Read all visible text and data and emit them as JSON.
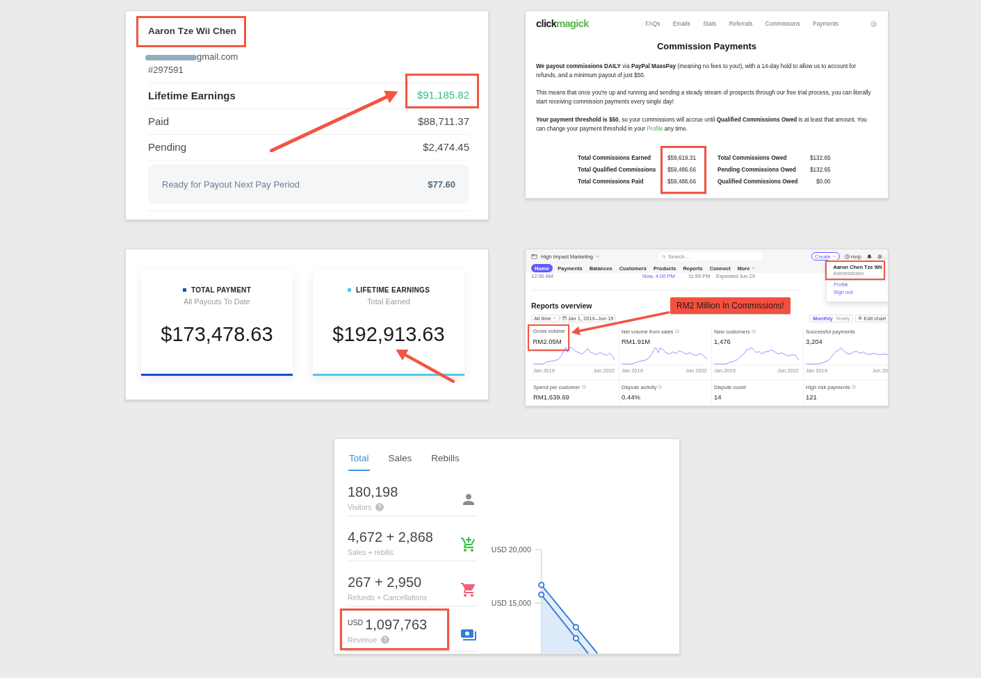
{
  "profile_card": {
    "name": "Aaron Tze Wii Chen",
    "name_highlighted": true,
    "email": "gmail.com",
    "email_redacted": true,
    "member_id": "#297591",
    "rows": [
      {
        "kind": "total",
        "label": "Lifetime Earnings",
        "value": "$91,185.82",
        "highlighted": true
      },
      {
        "kind": "plain",
        "label": "Paid",
        "value": "$88,711.37",
        "highlighted": false
      },
      {
        "kind": "plain",
        "label": "Pending",
        "value": "$2,474.45",
        "highlighted": false
      }
    ],
    "payout": {
      "label": "Ready for Payout Next Pay Period",
      "value": "$77.60"
    }
  },
  "commission_page": {
    "logo": [
      "click",
      "magick"
    ],
    "nav": [
      "FAQs",
      "Emails",
      "Stats",
      "Referrals",
      "Commissions",
      "Payments"
    ],
    "title": "Commission Payments",
    "paragraphs": [
      {
        "text": "**We payout commissions DAILY** via **PayPal MassPay** (meaning no fees to you!), with a 14-day hold to allow us to account for refunds, and a minimum payout of just $50."
      },
      {
        "text": "This means that once you're up and running and sending a steady stream of prospects through our free trial process, you can literally start receiving commission payments every single day!"
      },
      {
        "text": "**Your payment threshold is $50**, so your commissions will accrue until **Qualified Commissions Owed** is at least that amount. You can change your payment threshold in your ",
        "link": "Profile",
        "after": " any time."
      }
    ],
    "stat_groups": [
      {
        "values_highlighted": true,
        "rows": [
          {
            "label": "Total Commissions Earned",
            "value": "$59,619.31"
          },
          {
            "label": "Total Qualified Commissions",
            "value": "$59,486.66"
          },
          {
            "label": "Total Commissions Paid",
            "value": "$59,486.66"
          }
        ]
      },
      {
        "values_highlighted": false,
        "rows": [
          {
            "label": "Total Commissions Owed",
            "value": "$132.65"
          },
          {
            "label": "Pending Commissions Owed",
            "value": "$132.65"
          },
          {
            "label": "Qualified Commissions Owed",
            "value": "$0.00"
          }
        ]
      }
    ]
  },
  "payout_stats": {
    "cards": [
      {
        "label": "TOTAL PAYMENT",
        "subtitle": "All Payouts To Date",
        "value": "$173,478.63",
        "color": "#1748d8"
      },
      {
        "label": "LIFETIME EARNINGS",
        "subtitle": "Total Earned",
        "value": "$192,913.63",
        "color": "#4ccbe6"
      }
    ]
  },
  "dashboard": {
    "account": "High Impact Marketing",
    "search": {
      "placeholder": "Search…"
    },
    "create_button": "Create",
    "help": "Help",
    "nav": [
      {
        "label": "Home",
        "kind": "link",
        "selected": true
      },
      {
        "label": "Payments",
        "kind": "link",
        "selected": false
      },
      {
        "label": "Balances",
        "kind": "link",
        "selected": false
      },
      {
        "label": "Customers",
        "kind": "link",
        "selected": false
      },
      {
        "label": "Products",
        "kind": "link",
        "selected": false
      },
      {
        "label": "Reports",
        "kind": "link",
        "selected": false
      },
      {
        "label": "Connect",
        "kind": "link",
        "selected": false
      },
      {
        "label": "More",
        "kind": "menu",
        "selected": false
      }
    ],
    "today_axis": [
      {
        "text": "12:00 AM",
        "kind": "time"
      },
      {
        "text": "Now, 4:00 PM",
        "kind": "now"
      },
      {
        "text": "11:59 PM",
        "kind": "time"
      },
      {
        "text": "Expected Jun 29",
        "kind": "note"
      }
    ],
    "account_menu": {
      "name": "Aaron Chen Tze Wii",
      "role": "Administrator",
      "highlighted": true,
      "links": [
        "Profile",
        "Sign out"
      ]
    },
    "heading": "Reports overview",
    "callout": "RM2 Million In Commissions!",
    "filters": {
      "preset": "All time",
      "range": "Jan 1, 2019–Jun 15"
    },
    "interval": [
      {
        "label": "Monthly",
        "selected": true
      },
      {
        "label": "Yearly",
        "selected": false
      }
    ],
    "edit_chart": "Edit chart",
    "metrics": [
      {
        "label": "Gross volume",
        "value": "RM2.05M",
        "info": false,
        "highlighted": true,
        "axis_start": "Jan 2019",
        "axis_end": "Jun 2022"
      },
      {
        "label": "Net volume from sales",
        "value": "RM1.91M",
        "info": true,
        "highlighted": false,
        "axis_start": "Jan 2019",
        "axis_end": "Jun 2022"
      },
      {
        "label": "New customers",
        "value": "1,476",
        "info": true,
        "highlighted": false,
        "axis_start": "Jan 2019",
        "axis_end": "Jun 2022"
      },
      {
        "label": "Successful payments",
        "value": "3,204",
        "info": false,
        "highlighted": false,
        "axis_start": "Jan 2019",
        "axis_end": "Jun 20"
      }
    ],
    "secondary_metrics": [
      {
        "label": "Spend per customer",
        "value": "RM1,639.69",
        "info": true
      },
      {
        "label": "Dispute activity",
        "value": "0.44%",
        "info": true
      },
      {
        "label": "Dispute count",
        "value": "14",
        "info": false
      },
      {
        "label": "High risk payments",
        "value": "121",
        "info": true
      }
    ]
  },
  "analytics": {
    "tabs": [
      {
        "label": "Total",
        "selected": true
      },
      {
        "label": "Sales",
        "selected": false
      },
      {
        "label": "Rebills",
        "selected": false
      }
    ],
    "stats": [
      {
        "kind": "visitors",
        "value": "180,198",
        "label": "Visitors",
        "help": true,
        "highlighted": false
      },
      {
        "kind": "sales",
        "value": "4,672 + 2,868",
        "label": "Sales + rebills",
        "help": false,
        "highlighted": false
      },
      {
        "kind": "refunds",
        "value": "267 + 2,950",
        "label": "Refunds + Cancellations",
        "help": false,
        "highlighted": false
      },
      {
        "kind": "revenue",
        "currency": "USD",
        "value": "1,097,763",
        "label": "Revenue",
        "help": true,
        "highlighted": true
      }
    ],
    "chart": {
      "tick_labels": [
        "USD 20,000",
        "USD 15,000"
      ]
    }
  }
}
